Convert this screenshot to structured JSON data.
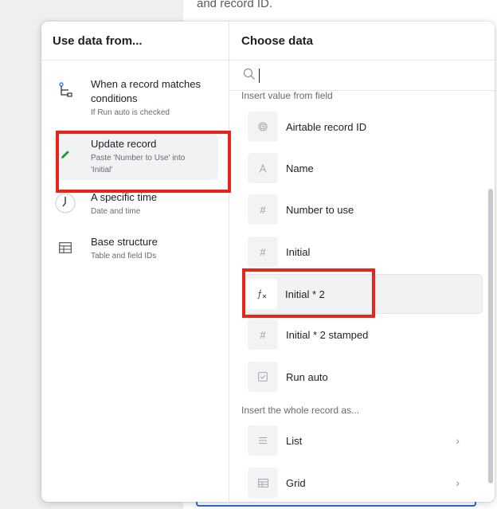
{
  "background": {
    "text": "and record ID."
  },
  "left_column": {
    "header": "Use data from...",
    "items": [
      {
        "title": "When a record matches conditions",
        "subtitle": "If Run auto is checked",
        "icon": "branch-icon"
      },
      {
        "title": "Update record",
        "subtitle": "Paste 'Number to Use' into 'Initial'",
        "icon": "pencil-icon"
      },
      {
        "title": "A specific time",
        "subtitle": "Date and time",
        "icon": "clock-icon"
      },
      {
        "title": "Base structure",
        "subtitle": "Table and field IDs",
        "icon": "table-icon"
      }
    ]
  },
  "right_column": {
    "header": "Choose data",
    "search": {
      "value": "",
      "placeholder": ""
    },
    "section_fields": "Insert value from field",
    "fields": [
      {
        "label": "Airtable record ID",
        "icon": "fingerprint-icon"
      },
      {
        "label": "Name",
        "icon": "text-icon"
      },
      {
        "label": "Number to use",
        "icon": "number-icon"
      },
      {
        "label": "Initial",
        "icon": "number-icon"
      },
      {
        "label": "Initial * 2",
        "icon": "formula-icon"
      },
      {
        "label": "Initial * 2 stamped",
        "icon": "number-icon"
      },
      {
        "label": "Run auto",
        "icon": "checkbox-icon"
      }
    ],
    "section_record": "Insert the whole record as...",
    "record_formats": [
      {
        "label": "List",
        "icon": "list-icon"
      },
      {
        "label": "Grid",
        "icon": "grid-icon"
      }
    ]
  },
  "colors": {
    "highlight_border": "#e8251a",
    "pencil_green": "#1a9a3c"
  }
}
